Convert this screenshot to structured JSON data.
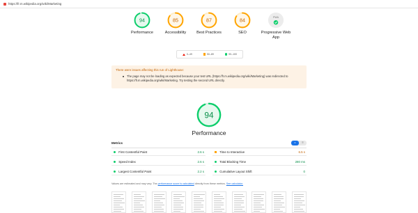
{
  "browser": {
    "url": "https://fr.m.wikipedia.org/wiki/Marketing"
  },
  "gauges": [
    {
      "score": "94",
      "label": "Performance",
      "color": "#0cce6b",
      "fraction": 0.94
    },
    {
      "score": "85",
      "label": "Accessibility",
      "color": "#ffa400",
      "fraction": 0.85
    },
    {
      "score": "87",
      "label": "Best Practices",
      "color": "#ffa400",
      "fraction": 0.87
    },
    {
      "score": "84",
      "label": "SEO",
      "color": "#ffa400",
      "fraction": 0.84
    },
    {
      "score": "PWA",
      "label": "Progressive Web App",
      "color": "#9e9e9e",
      "fraction": 0
    }
  ],
  "legend": {
    "fail": "0–49",
    "average": "50–89",
    "pass": "90–100"
  },
  "warning": {
    "title": "There were issues affecting this run of Lighthouse:",
    "message": "The page may not be loading as expected because your test URL (https://fr.m.wikipedia.org/wiki/Marketing) was redirected to https://fr.m.wikipedia.org/wiki/Marketing. Try testing the second URL directly."
  },
  "performance": {
    "score": "94",
    "title": "Performance",
    "fraction": 0.94
  },
  "metrics": {
    "title": "Metrics",
    "toggle_on": "≡",
    "toggle_off": "☰",
    "items": [
      {
        "label": "First Contentful Paint",
        "value": "2.6 s",
        "status": "pass"
      },
      {
        "label": "Time to Interactive",
        "value": "6.5 s",
        "status": "average"
      },
      {
        "label": "Speed Index",
        "value": "2.6 s",
        "status": "pass"
      },
      {
        "label": "Total Blocking Time",
        "value": "280 ms",
        "status": "pass"
      },
      {
        "label": "Largest Contentful Paint",
        "value": "2.2 s",
        "status": "pass"
      },
      {
        "label": "Cumulative Layout Shift",
        "value": "0",
        "status": "pass"
      }
    ]
  },
  "note": {
    "prefix": "Values are estimated and may vary. The ",
    "link1": "performance score is calculated",
    "middle": " directly from these metrics. ",
    "link2": "See calculator."
  },
  "colors": {
    "pass": "#0cce6b",
    "average": "#ffa400",
    "fail": "#eb0f00",
    "accent": "#1a73e8"
  }
}
